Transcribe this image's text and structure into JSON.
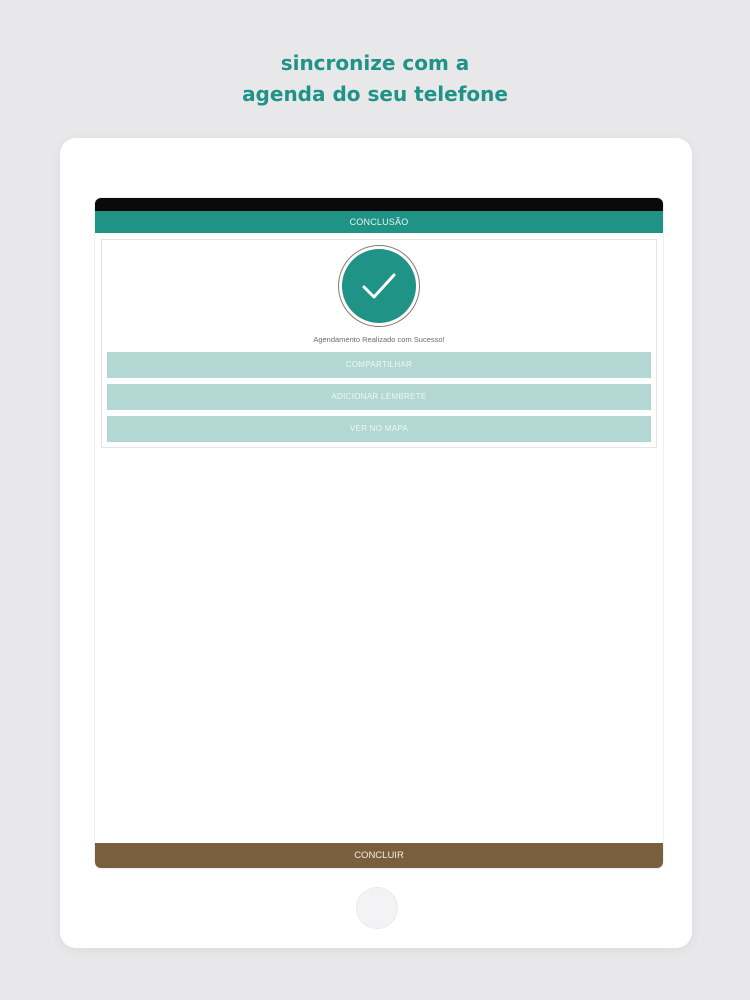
{
  "headline": {
    "line1": "sincronize com a",
    "line2": "agenda do seu telefone"
  },
  "app": {
    "title": "CONCLUSÃO",
    "success_icon": "check-icon",
    "success_message": "Agendamento Realizado com Sucesso!",
    "actions": [
      {
        "label": "COMPARTILHAR"
      },
      {
        "label": "ADICIONAR LEMBRETE"
      },
      {
        "label": "VER NO MAPA"
      }
    ],
    "finish_label": "CONCLUIR"
  },
  "colors": {
    "accent": "#1f9385",
    "action_button": "#b3d8d4",
    "finish_bar": "#7a5f3e",
    "background": "#e8e8ea"
  }
}
